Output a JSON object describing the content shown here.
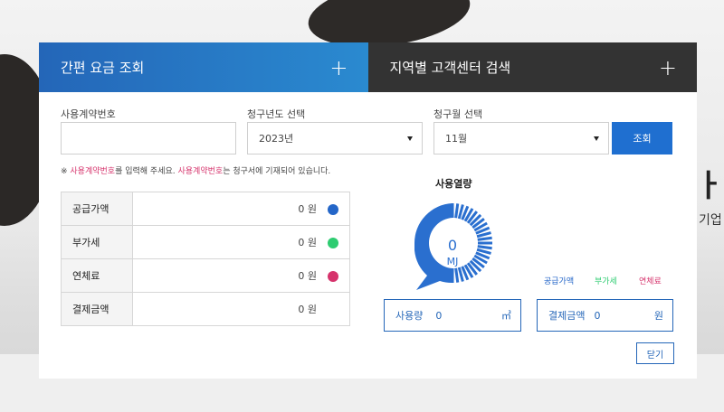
{
  "tabs": [
    {
      "label": "간편 요금 조회",
      "icon": "plus-icon"
    },
    {
      "label": "지역별 고객센터 검색",
      "icon": "plus-icon"
    }
  ],
  "form": {
    "contract_label": "사용계약번호",
    "contract_value": "",
    "year_label": "청구년도 선택",
    "year_value": "2023년",
    "month_label": "청구월 선택",
    "month_value": "11월",
    "query_button": "조회"
  },
  "notice": {
    "prefix": "※ ",
    "highlight1": "사용계약번호",
    "mid": "를 입력해 주세요. ",
    "highlight2": "사용계약번호",
    "suffix": "는 청구서에 기재되어 있습니다."
  },
  "fees": [
    {
      "label": "공급가액",
      "value": "0 원",
      "color": "#2466c8"
    },
    {
      "label": "부가세",
      "value": "0 원",
      "color": "#2ecc71"
    },
    {
      "label": "연체료",
      "value": "0 원",
      "color": "#d6336c"
    },
    {
      "label": "결제금액",
      "value": "0 원",
      "color": ""
    }
  ],
  "gauge": {
    "title": "사용열량",
    "value": "0",
    "unit": "MJ",
    "color": "#2a6fcf"
  },
  "legend": [
    {
      "label": "공급가액",
      "color": "#2466c8"
    },
    {
      "label": "부가세",
      "color": "#2ecc71"
    },
    {
      "label": "연체료",
      "color": "#d6336c"
    }
  ],
  "usage_box": {
    "label": "사용량",
    "value": "0",
    "unit": "㎥"
  },
  "payment_box": {
    "label": "결제금액",
    "value": "0",
    "unit": "원"
  },
  "close_button": "닫기",
  "background": {
    "headline_fragment": "ㅏ.",
    "side_fragment": "기업"
  }
}
